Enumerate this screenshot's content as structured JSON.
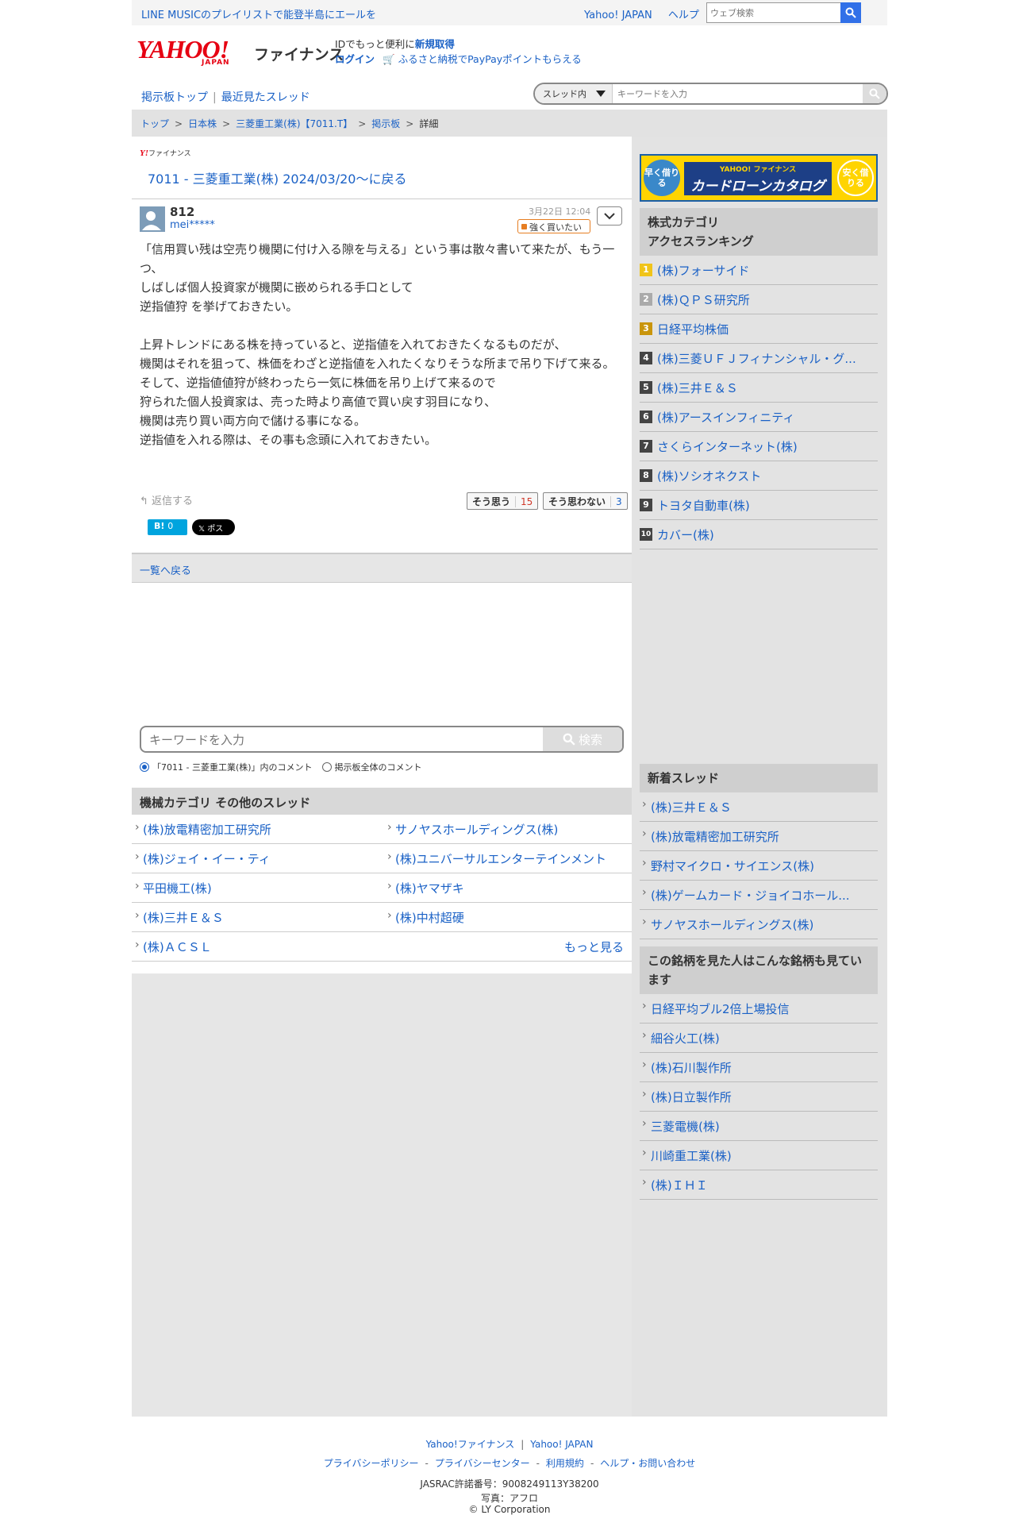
{
  "topbar": {
    "promo": "LINE MUSICのプレイリストで能登半島にエールを",
    "yahoo_japan": "Yahoo! JAPAN",
    "help": "ヘルプ",
    "web_search_placeholder": "ウェブ検索"
  },
  "header": {
    "logo_yahoo": "YAHOO!",
    "logo_japan": "JAPAN",
    "logo_finance": "ファイナンス",
    "id_text": "IDでもっと便利に",
    "signup": "新規取得",
    "login": "ログイン",
    "furusato": "ふるさと納税でPayPayポイントもらえる"
  },
  "nav": {
    "board_top": "掲示板トップ",
    "recent": "最近見たスレッド",
    "scope": "スレッド内",
    "keyword_placeholder": "キーワードを入力"
  },
  "breadcrumb": [
    "トップ",
    "日本株",
    "三菱重工業(株)【7011.T】",
    "掲示板",
    "詳細"
  ],
  "post": {
    "mini_logo": "Y!",
    "mini_logo_text": "ファイナンス",
    "thread_title": "7011 - 三菱重工業(株) 2024/03/20〜に戻る",
    "number": "812",
    "user": "mei*****",
    "date": "3月22日 12:04",
    "sentiment": "強く買いたい",
    "body": [
      "「信用買い残は空売り機関に付け入る隙を与える」という事は散々書いて来たが、もう一つ、",
      "しばしば個人投資家が機関に嵌められる手口として",
      "逆指値狩 を挙げておきたい。",
      "",
      "上昇トレンドにある株を持っていると、逆指値を入れておきたくなるものだが、",
      "機関はそれを狙って、株価をわざと逆指値を入れたくなりそうな所まで吊り下げて来る。",
      "そして、逆指値値狩が終わったら一気に株価を吊り上げて来るので",
      "狩られた個人投資家は、売った時より高値で買い戻す羽目になり、",
      "機関は売り買い両方向で儲ける事になる。",
      "逆指値を入れる際は、その事も念頭に入れておきたい。"
    ],
    "reply": "返信する",
    "agree_label": "そう思う",
    "agree_count": "15",
    "disagree_label": "そう思わない",
    "disagree_count": "3",
    "hatena_label": "B!",
    "hatena_count": "0",
    "x_label": "𝕏 ポスト"
  },
  "back_to_list": "一覧へ戻る",
  "keyword_search": {
    "placeholder": "キーワードを入力",
    "button": "検索",
    "radio_thread": "「7011 - 三菱重工業(株)」内のコメント",
    "radio_all": "掲示板全体のコメント"
  },
  "other_threads": {
    "heading": "機械カテゴリ その他のスレッド",
    "items": [
      "(株)放電精密加工研究所",
      "サノヤスホールディングス(株)",
      "(株)ジェイ・イー・ティ",
      "(株)ユニバーサルエンターテインメント",
      "平田機工(株)",
      "(株)ヤマザキ",
      "(株)三井Ｅ＆Ｓ",
      "(株)中村超硬",
      "(株)ＡＣＳＬ"
    ],
    "more": "もっと見る"
  },
  "sidebar": {
    "banner_left": "早く借りる",
    "banner_brand": "YAHOO! ファイナンス",
    "banner_title": "カードローンカタログ",
    "banner_right": "安く借りる",
    "ranking_heading_1": "株式カテゴリ",
    "ranking_heading_2": "アクセスランキング",
    "ranking": [
      {
        "rank": "1",
        "name": "(株)フォーサイド",
        "color": "#f0c419"
      },
      {
        "rank": "2",
        "name": "(株)ＱＰＳ研究所",
        "color": "#aaaaaa"
      },
      {
        "rank": "3",
        "name": "日経平均株価",
        "color": "#c9950c"
      },
      {
        "rank": "4",
        "name": "(株)三菱ＵＦＪフィナンシャル・グ...",
        "color": "#444444"
      },
      {
        "rank": "5",
        "name": "(株)三井Ｅ＆Ｓ",
        "color": "#444444"
      },
      {
        "rank": "6",
        "name": "(株)アースインフィニティ",
        "color": "#444444"
      },
      {
        "rank": "7",
        "name": "さくらインターネット(株)",
        "color": "#444444"
      },
      {
        "rank": "8",
        "name": "(株)ソシオネクスト",
        "color": "#444444"
      },
      {
        "rank": "9",
        "name": "トヨタ自動車(株)",
        "color": "#444444"
      },
      {
        "rank": "10",
        "name": "カバー(株)",
        "color": "#444444"
      }
    ],
    "new_heading": "新着スレッド",
    "new_threads": [
      "(株)三井Ｅ＆Ｓ",
      "(株)放電精密加工研究所",
      "野村マイクロ・サイエンス(株)",
      "(株)ゲームカード・ジョイコホール...",
      "サノヤスホールディングス(株)"
    ],
    "also_heading": "この銘柄を見た人はこんな銘柄も見ています",
    "also": [
      "日経平均ブル2倍上場投信",
      "細谷火工(株)",
      "(株)石川製作所",
      "(株)日立製作所",
      "三菱電機(株)",
      "川崎重工業(株)",
      "(株)ＩＨＩ"
    ]
  },
  "footer": {
    "finance": "Yahoo!ファイナンス",
    "yahoo_japan": "Yahoo! JAPAN",
    "privacy_policy": "プライバシーポリシー",
    "privacy_center": "プライバシーセンター",
    "terms": "利用規約",
    "help": "ヘルプ・お問い合わせ",
    "jasrac": "JASRAC許諾番号：9008249113Y38200",
    "photo": "写真：アフロ",
    "copyright": "© LY Corporation"
  },
  "colors": {
    "link": "#1a61c6",
    "brand_red": "#e60012",
    "sentiment": "#e67e22"
  }
}
